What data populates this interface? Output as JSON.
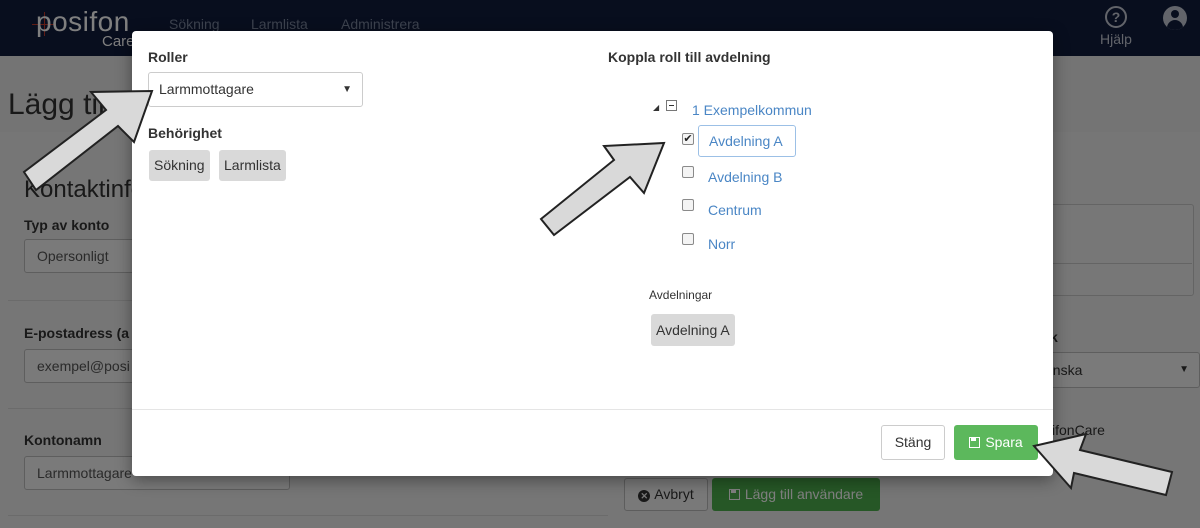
{
  "navbar": {
    "logo": "posifon",
    "logo_sub": "Care",
    "links": [
      "Sökning",
      "Larmlista",
      "Administrera"
    ],
    "help_label": "Hjälp"
  },
  "background_page": {
    "title": "Lägg till n",
    "section_title": "Kontaktinfo",
    "account_type_label": "Typ av konto",
    "account_type_value": "Opersonligt",
    "email_label": "E-postadress (a",
    "email_value": "exempel@posi",
    "account_name_label": "Kontonamn",
    "account_name_value": "Larmmottagare",
    "right_label": "k",
    "right_select_value": "enska",
    "right_text": "ifonCare",
    "cancel_label": "Avbryt",
    "add_user_label": "Lägg till användare"
  },
  "modal": {
    "roles_label": "Roller",
    "role_selected": "Larmmottagare",
    "permissions_label": "Behörighet",
    "permissions": [
      "Sökning",
      "Larmlista"
    ],
    "connect_label": "Koppla roll till avdelning",
    "tree": {
      "root": "1 Exempelkommun",
      "items": [
        {
          "label": "Avdelning A",
          "checked": true
        },
        {
          "label": "Avdelning B",
          "checked": false
        },
        {
          "label": "Centrum",
          "checked": false
        },
        {
          "label": "Norr",
          "checked": false
        }
      ]
    },
    "departments_label": "Avdelningar",
    "departments": [
      "Avdelning A"
    ],
    "close_label": "Stäng",
    "save_label": "Spara"
  },
  "colors": {
    "navbar": "#101c3d",
    "link": "#4a86c5",
    "save": "#5cb85c",
    "add_user": "#4cae4c"
  }
}
